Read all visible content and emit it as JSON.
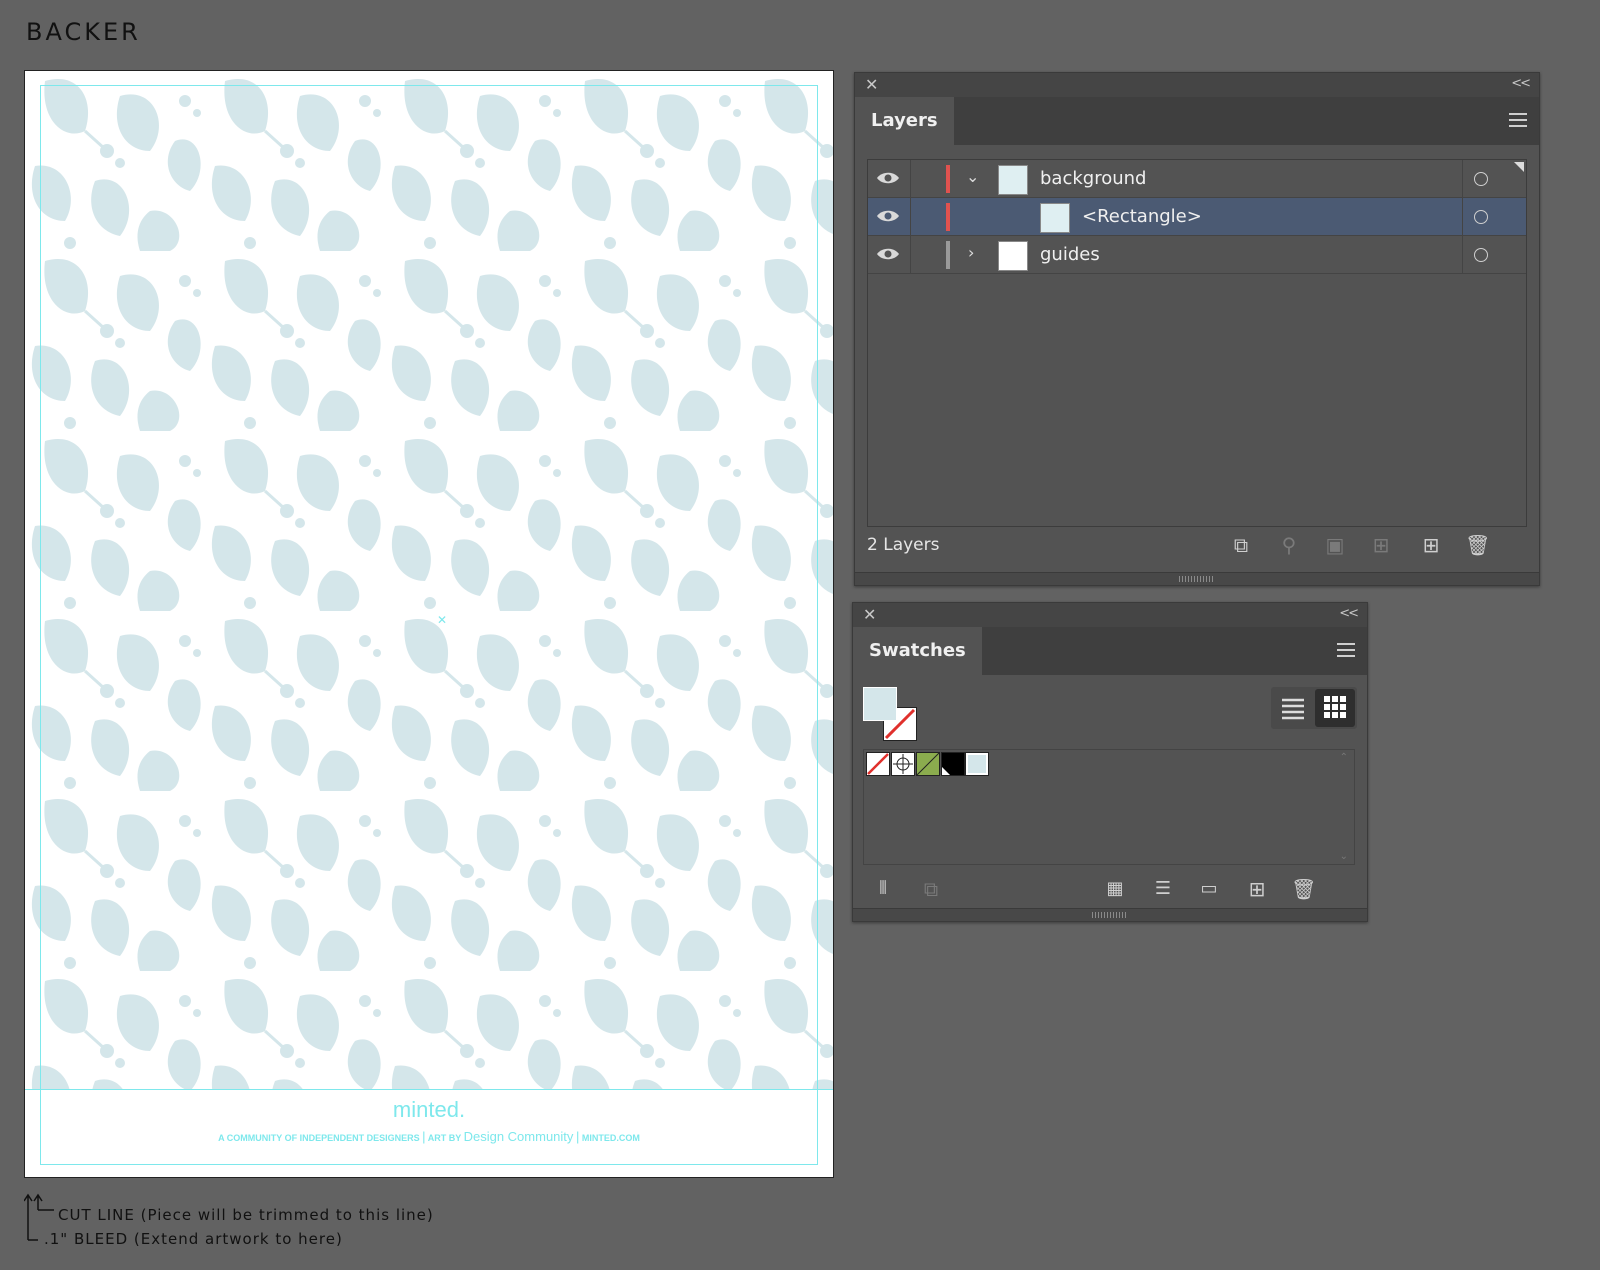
{
  "page": {
    "title": "BACKER"
  },
  "artboard": {
    "brand": "minted.",
    "tagline_left": "A COMMUNITY OF INDEPENDENT DESIGNERS",
    "tagline_sep": "|",
    "tagline_art_prefix": "ART BY",
    "tagline_artist": "Design Community",
    "tagline_site": "MINTED.COM",
    "pattern_color": "#d4e6ea",
    "guide_color": "#7ee8ec"
  },
  "legend": {
    "cut_line": "CUT LINE (Piece will be trimmed to this line)",
    "bleed": ".1\" BLEED (Extend artwork to here)"
  },
  "layers_panel": {
    "close_glyph": "✕",
    "collapse_glyph": "<<",
    "tab_label": "Layers",
    "rows": [
      {
        "name": "background",
        "visible": true,
        "expanded": true,
        "color": "#e0524f",
        "selected": false
      },
      {
        "name": "<Rectangle>",
        "visible": true,
        "color": "#e0524f",
        "selected": true
      },
      {
        "name": "guides",
        "visible": true,
        "expanded": false,
        "color": "#9a9a9a",
        "selected": false
      }
    ],
    "count_text": "2 Layers",
    "footer_icons": [
      "export-icon",
      "locate-object-icon",
      "make-clipping-mask-icon",
      "create-sublayer-icon",
      "new-layer-icon",
      "delete-icon"
    ]
  },
  "swatches_panel": {
    "close_glyph": "✕",
    "collapse_glyph": "<<",
    "tab_label": "Swatches",
    "swatches": [
      {
        "name": "none-swatch",
        "color": "#ffffff"
      },
      {
        "name": "registration-swatch",
        "color": "#ffffff"
      },
      {
        "name": "green-swatch",
        "color": "#8bac4e"
      },
      {
        "name": "black-swatch",
        "color": "#000000"
      },
      {
        "name": "light-blue-swatch",
        "color": "#d4e6ea"
      }
    ],
    "footer_icons": [
      "swatch-libraries-icon",
      "place-swatches-icon",
      "show-swatch-kinds-icon",
      "swatch-options-icon",
      "new-color-group-icon",
      "new-swatch-icon",
      "delete-swatch-icon"
    ]
  }
}
